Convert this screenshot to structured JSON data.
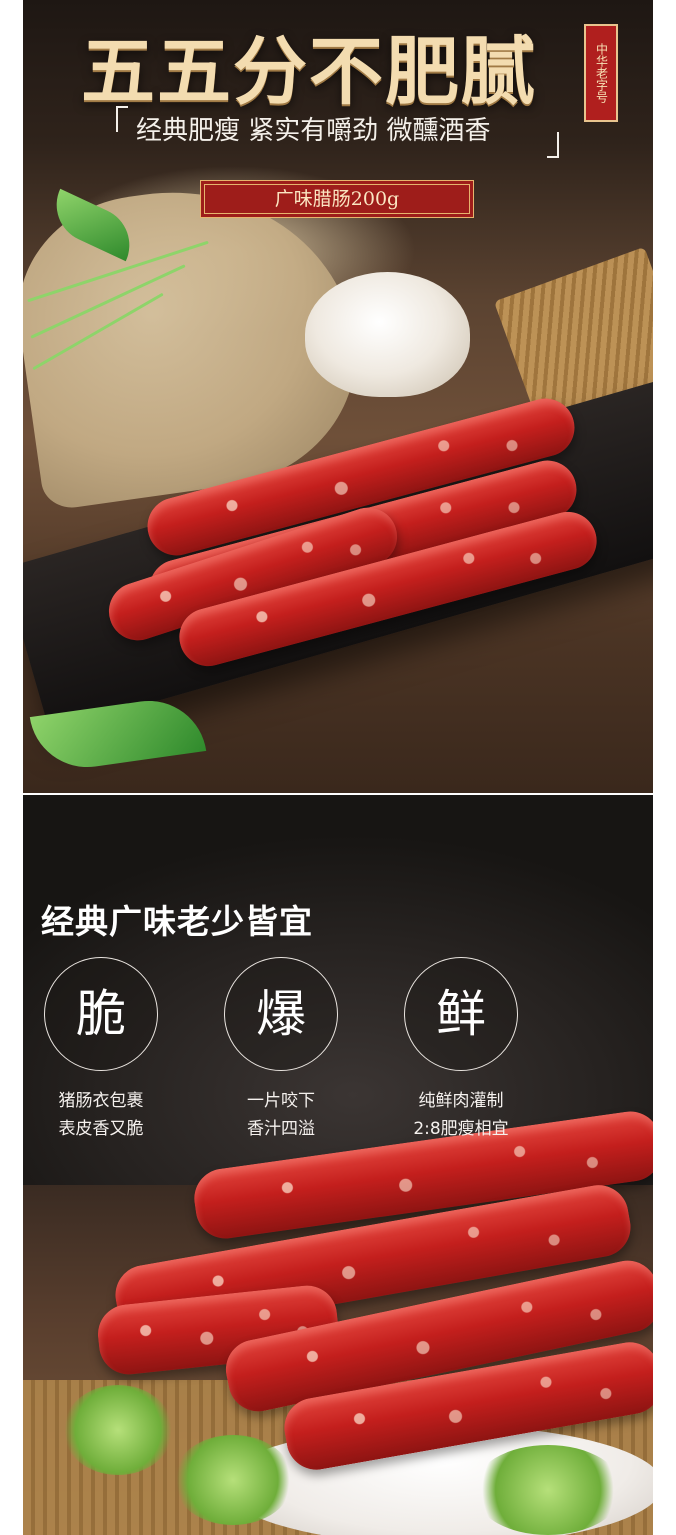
{
  "hero": {
    "title": "五五分不肥腻",
    "seal_text": "中华老字号",
    "subtitle": "经典肥瘦 紧实有嚼劲 微醺酒香",
    "product_tag": "广味腊肠200g"
  },
  "features": {
    "heading": "经典广味老少皆宜",
    "items": [
      {
        "char": "脆",
        "line1": "猪肠衣包裹",
        "line2": "表皮香又脆"
      },
      {
        "char": "爆",
        "line1": "一片咬下",
        "line2": "香汁四溢"
      },
      {
        "char": "鲜",
        "line1": "纯鲜肉灌制",
        "line2": "2:8肥瘦相宜"
      }
    ]
  },
  "colors": {
    "accent_red": "#9e1d1a",
    "gold": "#f3dcb0",
    "dark_bg": "#262220"
  }
}
